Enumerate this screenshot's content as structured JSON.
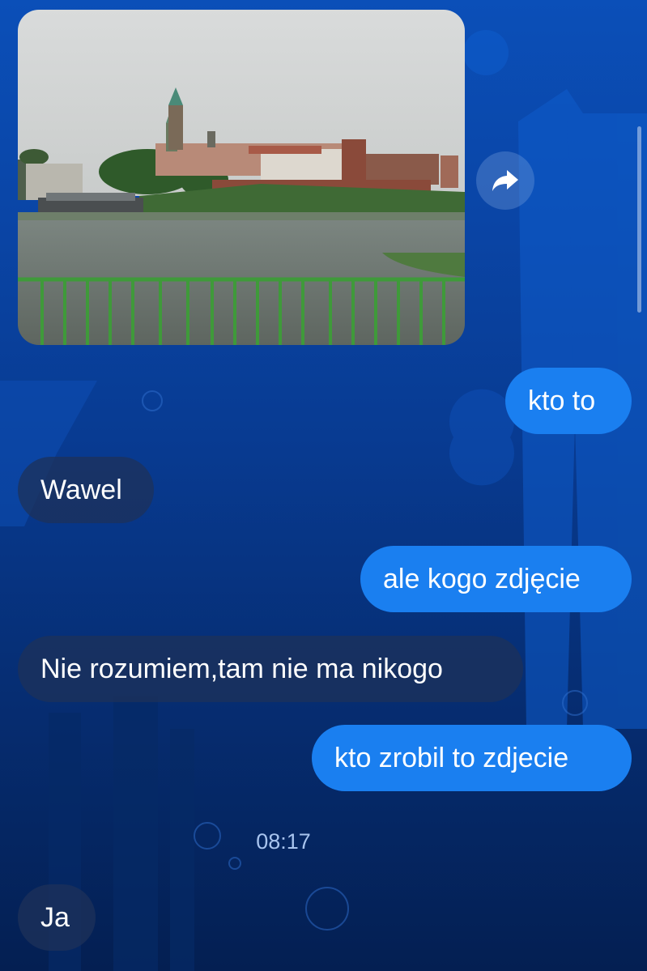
{
  "messages": [
    {
      "id": "m1",
      "side": "out",
      "text": "kto to"
    },
    {
      "id": "m2",
      "side": "in",
      "text": "Wawel"
    },
    {
      "id": "m3",
      "side": "out",
      "text": "ale kogo zdjęcie"
    },
    {
      "id": "m4",
      "side": "in",
      "text": "Nie rozumiem,tam nie ma nikogo"
    },
    {
      "id": "m5",
      "side": "out",
      "text": "kto zrobil to zdjecie"
    },
    {
      "id": "m6",
      "side": "in",
      "text": "Ja"
    }
  ],
  "timestamp": "08:17",
  "icons": {
    "share": "share-forward-icon"
  },
  "colors": {
    "outgoing_bubble": "#1a7ff0",
    "incoming_bubble": "#1e325a",
    "background": "#0a46a8"
  }
}
